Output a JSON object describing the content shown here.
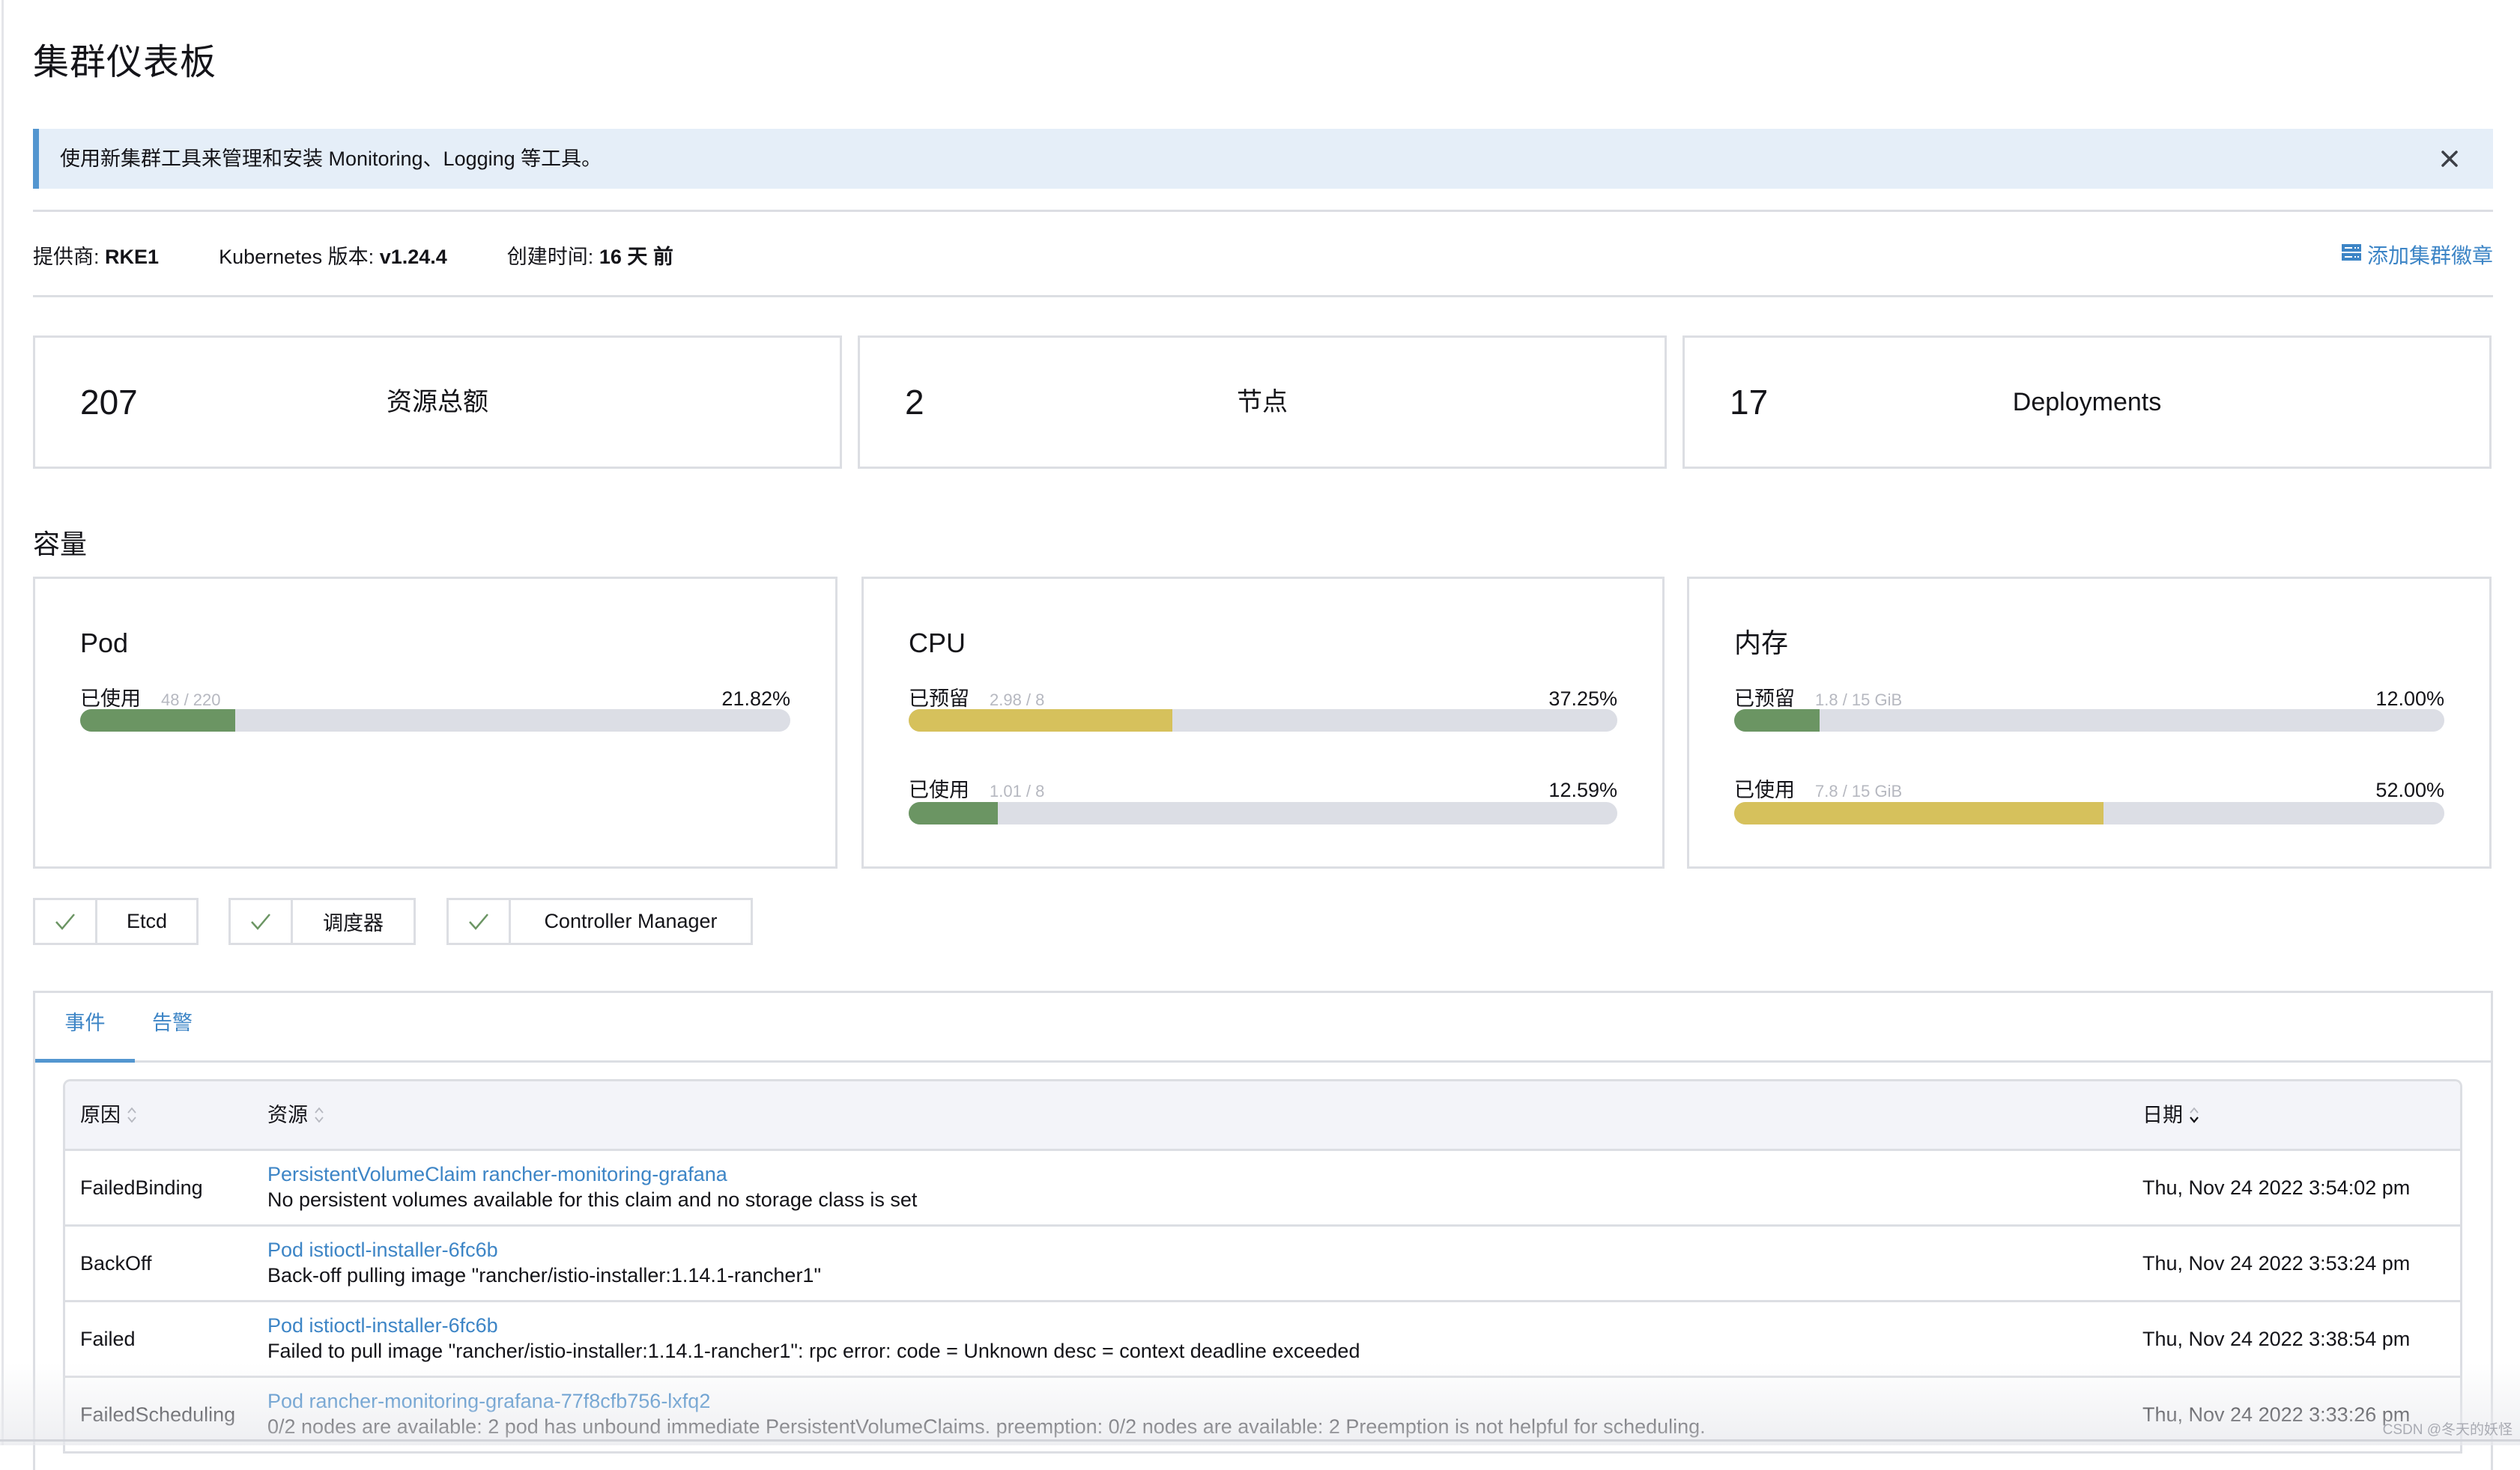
{
  "page": {
    "title": "集群仪表板"
  },
  "banner": {
    "text": "使用新集群工具来管理和安装 Monitoring、Logging 等工具。",
    "close_icon": "close-icon",
    "accent_color": "#5396d0"
  },
  "info": {
    "provider_label": "提供商:",
    "provider_value": "RKE1",
    "k8s_label": "Kubernetes 版本:",
    "k8s_value": "v1.24.4",
    "created_label": "创建时间:",
    "created_value": "16 天 前",
    "add_badge_label": "添加集群徽章",
    "add_badge_icon": "server-icon"
  },
  "stats": [
    {
      "value": "207",
      "label": "资源总额"
    },
    {
      "value": "2",
      "label": "节点"
    },
    {
      "value": "17",
      "label": "Deployments"
    }
  ],
  "capacity": {
    "title": "容量",
    "cards": [
      {
        "title": "Pod",
        "rows": [
          {
            "label": "已使用",
            "fraction": "48 / 220",
            "percent_text": "21.82%",
            "percent": 21.82,
            "color": "#6b9563"
          }
        ]
      },
      {
        "title": "CPU",
        "rows": [
          {
            "label": "已预留",
            "fraction": "2.98 / 8",
            "percent_text": "37.25%",
            "percent": 37.25,
            "color": "#d6c15c"
          },
          {
            "label": "已使用",
            "fraction": "1.01 / 8",
            "percent_text": "12.59%",
            "percent": 12.59,
            "color": "#6b9563"
          }
        ]
      },
      {
        "title": "内存",
        "rows": [
          {
            "label": "已预留",
            "fraction": "1.8 / 15 GiB",
            "percent_text": "12.00%",
            "percent": 12.0,
            "color": "#6b9563"
          },
          {
            "label": "已使用",
            "fraction": "7.8 / 15 GiB",
            "percent_text": "52.00%",
            "percent": 52.0,
            "color": "#d6c15c"
          }
        ]
      }
    ]
  },
  "components": [
    {
      "name": "Etcd",
      "status": "healthy",
      "icon": "check-icon"
    },
    {
      "name": "调度器",
      "status": "healthy",
      "icon": "check-icon"
    },
    {
      "name": "Controller Manager",
      "status": "healthy",
      "icon": "check-icon"
    }
  ],
  "tabs": [
    {
      "label": "事件",
      "active": true
    },
    {
      "label": "告警",
      "active": false
    }
  ],
  "events_table": {
    "columns": [
      {
        "label": "原因",
        "sort": "none"
      },
      {
        "label": "资源",
        "sort": "none"
      },
      {
        "label": "日期",
        "sort": "desc"
      }
    ],
    "rows": [
      {
        "reason": "FailedBinding",
        "resource": "PersistentVolumeClaim rancher-monitoring-grafana",
        "message": "No persistent volumes available for this claim and no storage class is set",
        "date": "Thu, Nov 24 2022  3:54:02 pm"
      },
      {
        "reason": "BackOff",
        "resource": "Pod istioctl-installer-6fc6b",
        "message": "Back-off pulling image \"rancher/istio-installer:1.14.1-rancher1\"",
        "date": "Thu, Nov 24 2022  3:53:24 pm"
      },
      {
        "reason": "Failed",
        "resource": "Pod istioctl-installer-6fc6b",
        "message": "Failed to pull image \"rancher/istio-installer:1.14.1-rancher1\": rpc error: code = Unknown desc = context deadline exceeded",
        "date": "Thu, Nov 24 2022  3:38:54 pm"
      },
      {
        "reason": "FailedScheduling",
        "resource": "Pod rancher-monitoring-grafana-77f8cfb756-lxfq2",
        "message": "0/2 nodes are available: 2 pod has unbound immediate PersistentVolumeClaims. preemption: 0/2 nodes are available: 2 Preemption is not helpful for scheduling.",
        "date": "Thu, Nov 24 2022  3:33:26 pm"
      }
    ]
  },
  "watermark": "CSDN @冬天的妖怪",
  "colors": {
    "link": "#3d85c6",
    "success": "#6b9563",
    "warning": "#d6c15c",
    "track": "#dcdee5",
    "border": "#dcdee3"
  }
}
